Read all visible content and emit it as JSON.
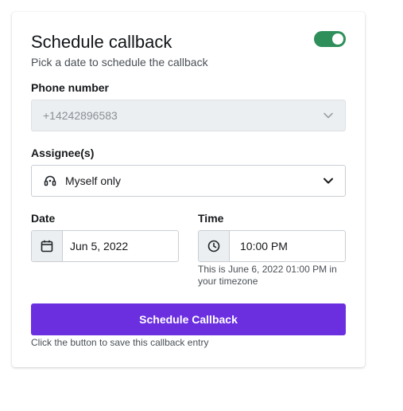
{
  "header": {
    "title": "Schedule callback",
    "subtitle": "Pick a date to schedule the callback",
    "toggle_on": true
  },
  "phone": {
    "label": "Phone number",
    "value": "+14242896583",
    "disabled": true
  },
  "assignee": {
    "label": "Assignee(s)",
    "value": "Myself only",
    "icon": "headset-icon"
  },
  "date": {
    "label": "Date",
    "value": "Jun 5, 2022",
    "icon": "calendar-icon"
  },
  "time": {
    "label": "Time",
    "value": "10:00 PM",
    "icon": "clock-icon",
    "note_line1": "This is June 6, 2022 01:00 PM in",
    "note_line2": "your timezone"
  },
  "action": {
    "button_label": "Schedule Callback",
    "hint": "Click the button to save this callback entry"
  },
  "colors": {
    "accent": "#6b2fe0",
    "toggle": "#2f8f5b"
  }
}
